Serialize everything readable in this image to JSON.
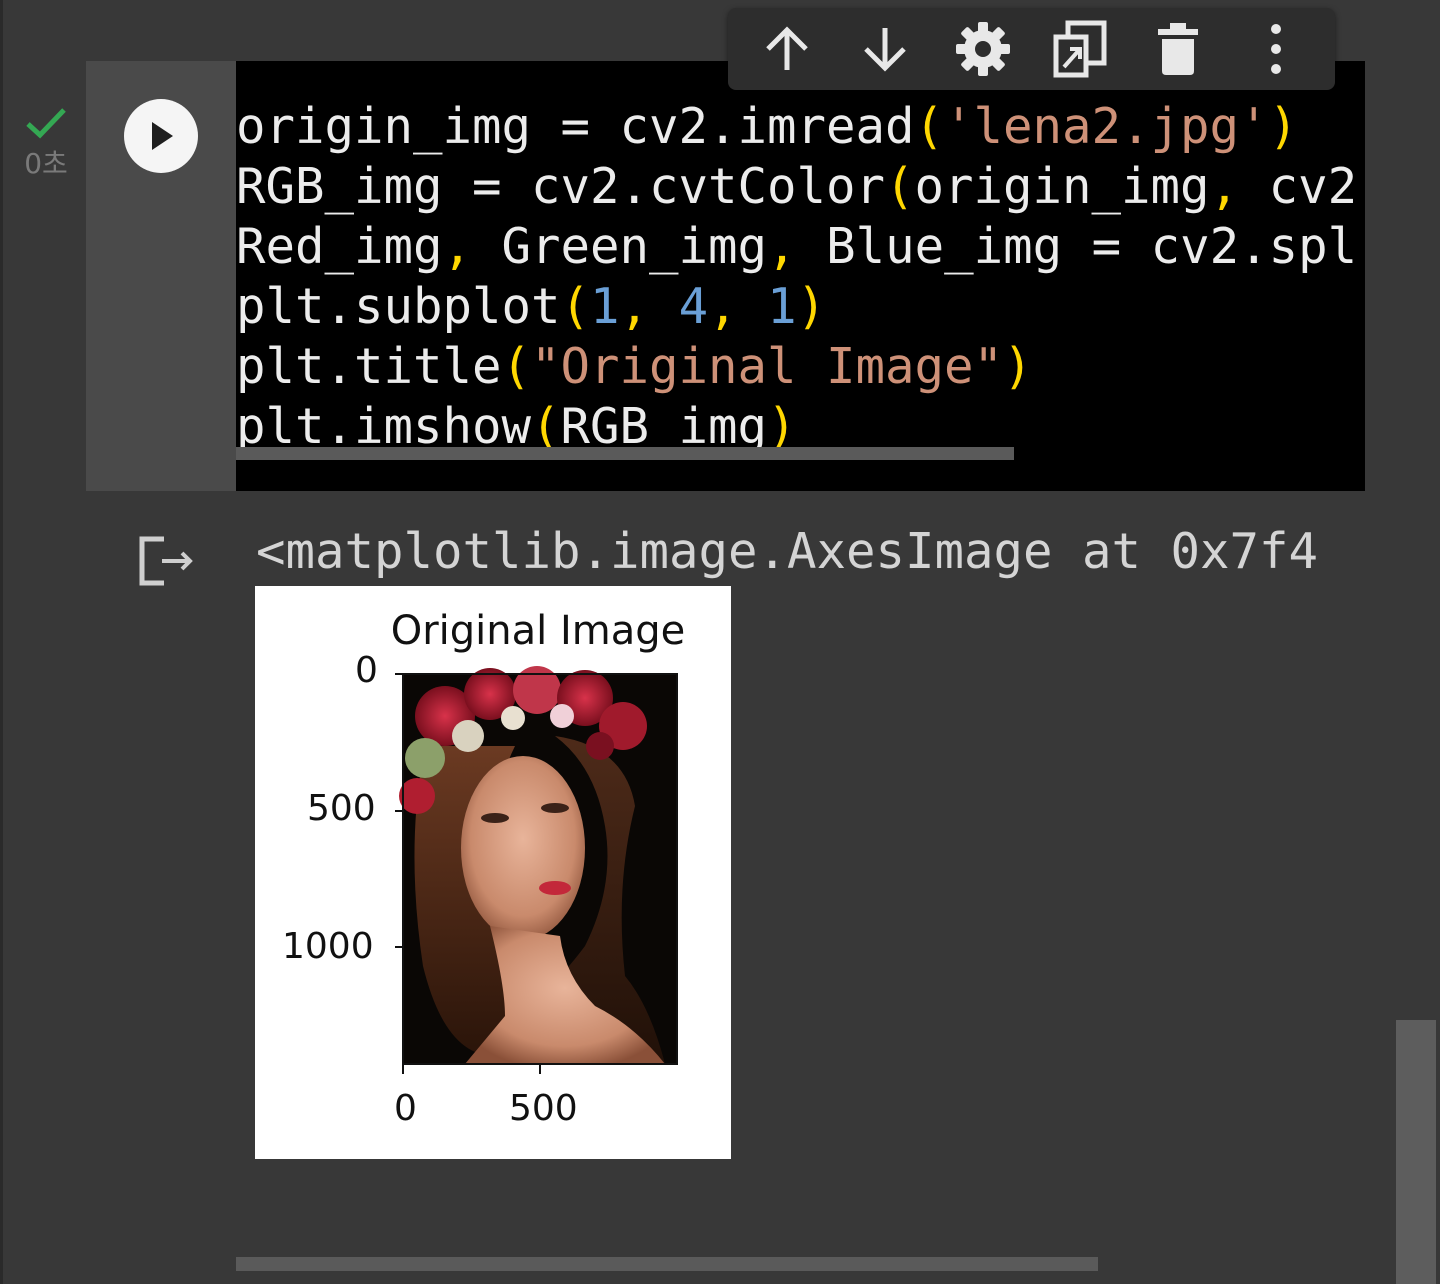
{
  "status": {
    "exec_time": "0초"
  },
  "toolbar": {
    "buttons": [
      "arrow-up-icon",
      "arrow-down-icon",
      "gear-icon",
      "mirror-cell-icon",
      "trash-icon",
      "more-vert-icon"
    ]
  },
  "code": {
    "lines": [
      "origin_img = cv2.imread('lena2.jpg')",
      "RGB_img = cv2.cvtColor(origin_img, cv2",
      "Red_img, Green_img, Blue_img = cv2.spl",
      "plt.subplot(1, 4, 1)",
      "plt.title(\"Original Image\")",
      "plt.imshow(RGB_img)"
    ]
  },
  "output": {
    "text": "<matplotlib.image.AxesImage at 0x7f4",
    "plot": {
      "title": "Original Image",
      "y_ticks": [
        "0",
        "500",
        "1000"
      ],
      "x_ticks": [
        "0",
        "500"
      ]
    }
  },
  "colors": {
    "check": "#34a853",
    "string": "#ce9178",
    "number": "#6a9fd6",
    "paren": "#ffd700"
  }
}
